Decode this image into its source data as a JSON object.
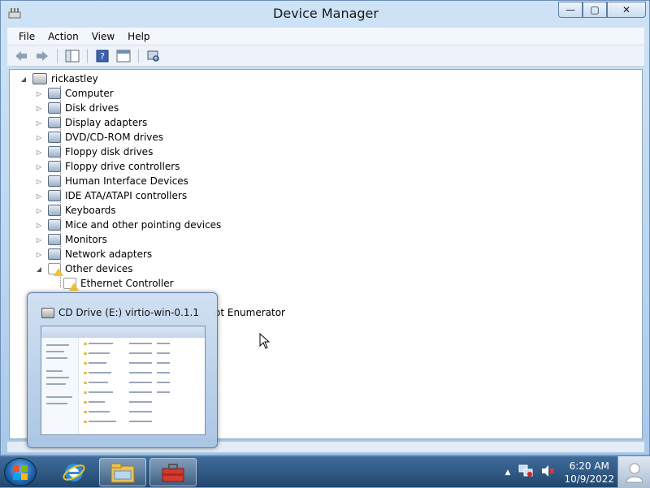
{
  "window": {
    "title": "Device Manager",
    "controls": {
      "minimize": "—",
      "maximize": "▢",
      "close": "✕"
    }
  },
  "menu": [
    "File",
    "Action",
    "View",
    "Help"
  ],
  "toolbar": {
    "icons": [
      "back-arrow-icon",
      "forward-arrow-icon",
      "show-hide-console-tree-icon",
      "help-icon",
      "properties-icon",
      "scan-hardware-icon"
    ]
  },
  "tree": {
    "root": "rickastley",
    "categories": [
      {
        "label": "Computer",
        "expanded": false
      },
      {
        "label": "Disk drives",
        "expanded": false
      },
      {
        "label": "Display adapters",
        "expanded": false
      },
      {
        "label": "DVD/CD-ROM drives",
        "expanded": false
      },
      {
        "label": "Floppy disk drives",
        "expanded": false
      },
      {
        "label": "Floppy drive controllers",
        "expanded": false
      },
      {
        "label": "Human Interface Devices",
        "expanded": false
      },
      {
        "label": "IDE ATA/ATAPI controllers",
        "expanded": false
      },
      {
        "label": "Keyboards",
        "expanded": false
      },
      {
        "label": "Mice and other pointing devices",
        "expanded": false
      },
      {
        "label": "Monitors",
        "expanded": false
      },
      {
        "label": "Network adapters",
        "expanded": false
      },
      {
        "label": "Other devices",
        "expanded": true
      }
    ],
    "other_devices_children": [
      "Ethernet Controller"
    ],
    "partial_label": "ot Enumerator"
  },
  "thumbnail": {
    "title": "CD Drive (E:) virtio-win-0.1.1"
  },
  "taskbar": {
    "time": "6:20 AM",
    "date": "10/9/2022",
    "apps": [
      "internet-explorer-icon",
      "windows-explorer-icon",
      "toolbox-icon"
    ]
  }
}
